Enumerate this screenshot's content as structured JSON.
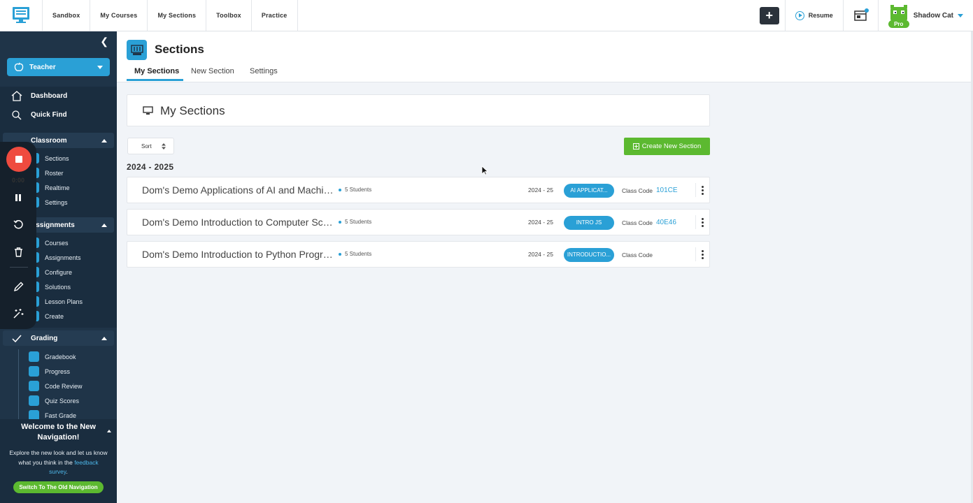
{
  "topbar": {
    "nav": [
      "Sandbox",
      "My Courses",
      "My Sections",
      "Toolbox",
      "Practice"
    ],
    "resume_label": "Resume",
    "user_name": "Shadow Cat",
    "pro_badge": "Pro",
    "colors": {
      "accent": "#2aa0d6",
      "green": "#5cb930",
      "dark": "#2b323b"
    }
  },
  "sidebar": {
    "role": "Teacher",
    "top_items": [
      "Dashboard",
      "Quick Find"
    ],
    "classroom": {
      "label": "Classroom",
      "items": [
        "Sections",
        "Roster",
        "Realtime",
        "Settings"
      ]
    },
    "assignments": {
      "label": "Assignments",
      "items": [
        "Courses",
        "Assignments",
        "Configure",
        "Solutions",
        "Lesson Plans",
        "Create"
      ]
    },
    "grading": {
      "label": "Grading",
      "items": [
        "Gradebook",
        "Progress",
        "Code Review",
        "Quiz Scores",
        "Fast Grade"
      ]
    },
    "welcome": {
      "title": "Welcome to the New Navigation!",
      "text_before": "Explore the new look and let us know what you think in the",
      "link": "feedback survey",
      "text_after": ".",
      "button": "Switch To The Old Navigation"
    }
  },
  "recorder": {
    "time": "0:00"
  },
  "page": {
    "title": "Sections",
    "tabs": [
      "My Sections",
      "New Section",
      "Settings"
    ],
    "card_title": "My Sections",
    "sort_label": "Sort",
    "create_label": "Create New Section",
    "year_heading": "2024 - 2025"
  },
  "sections": [
    {
      "name": "Dom's Demo Applications of AI and Machine Learning",
      "students": "5 Students",
      "year": "2024 - 25",
      "course": "AI APPLICAT...",
      "class_code_label": "Class Code",
      "class_code": "101CE"
    },
    {
      "name": "Dom's Demo Introduction to Computer Science in JavaScript",
      "students": "5 Students",
      "year": "2024 - 25",
      "course": "INTRO JS",
      "class_code_label": "Class Code",
      "class_code": "40E46"
    },
    {
      "name": "Dom's Demo Introduction to Python Programming",
      "students": "5 Students",
      "year": "2024 - 25",
      "course": "INTRODUCTIO...",
      "class_code_label": "Class Code",
      "class_code": ""
    }
  ]
}
